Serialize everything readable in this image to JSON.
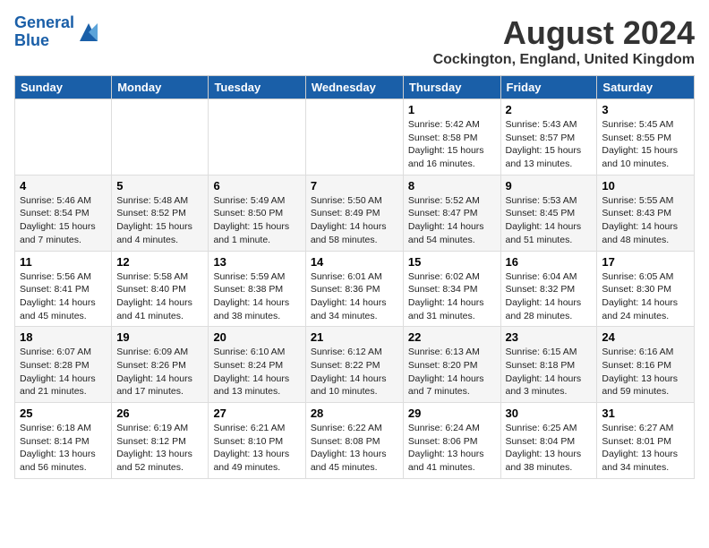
{
  "header": {
    "logo_line1": "General",
    "logo_line2": "Blue",
    "month_title": "August 2024",
    "location": "Cockington, England, United Kingdom"
  },
  "weekdays": [
    "Sunday",
    "Monday",
    "Tuesday",
    "Wednesday",
    "Thursday",
    "Friday",
    "Saturday"
  ],
  "weeks": [
    [
      null,
      null,
      null,
      null,
      {
        "day": "1",
        "sunrise": "5:42 AM",
        "sunset": "8:58 PM",
        "daylight": "15 hours and 16 minutes."
      },
      {
        "day": "2",
        "sunrise": "5:43 AM",
        "sunset": "8:57 PM",
        "daylight": "15 hours and 13 minutes."
      },
      {
        "day": "3",
        "sunrise": "5:45 AM",
        "sunset": "8:55 PM",
        "daylight": "15 hours and 10 minutes."
      }
    ],
    [
      {
        "day": "4",
        "sunrise": "5:46 AM",
        "sunset": "8:54 PM",
        "daylight": "15 hours and 7 minutes."
      },
      {
        "day": "5",
        "sunrise": "5:48 AM",
        "sunset": "8:52 PM",
        "daylight": "15 hours and 4 minutes."
      },
      {
        "day": "6",
        "sunrise": "5:49 AM",
        "sunset": "8:50 PM",
        "daylight": "15 hours and 1 minute."
      },
      {
        "day": "7",
        "sunrise": "5:50 AM",
        "sunset": "8:49 PM",
        "daylight": "14 hours and 58 minutes."
      },
      {
        "day": "8",
        "sunrise": "5:52 AM",
        "sunset": "8:47 PM",
        "daylight": "14 hours and 54 minutes."
      },
      {
        "day": "9",
        "sunrise": "5:53 AM",
        "sunset": "8:45 PM",
        "daylight": "14 hours and 51 minutes."
      },
      {
        "day": "10",
        "sunrise": "5:55 AM",
        "sunset": "8:43 PM",
        "daylight": "14 hours and 48 minutes."
      }
    ],
    [
      {
        "day": "11",
        "sunrise": "5:56 AM",
        "sunset": "8:41 PM",
        "daylight": "14 hours and 45 minutes."
      },
      {
        "day": "12",
        "sunrise": "5:58 AM",
        "sunset": "8:40 PM",
        "daylight": "14 hours and 41 minutes."
      },
      {
        "day": "13",
        "sunrise": "5:59 AM",
        "sunset": "8:38 PM",
        "daylight": "14 hours and 38 minutes."
      },
      {
        "day": "14",
        "sunrise": "6:01 AM",
        "sunset": "8:36 PM",
        "daylight": "14 hours and 34 minutes."
      },
      {
        "day": "15",
        "sunrise": "6:02 AM",
        "sunset": "8:34 PM",
        "daylight": "14 hours and 31 minutes."
      },
      {
        "day": "16",
        "sunrise": "6:04 AM",
        "sunset": "8:32 PM",
        "daylight": "14 hours and 28 minutes."
      },
      {
        "day": "17",
        "sunrise": "6:05 AM",
        "sunset": "8:30 PM",
        "daylight": "14 hours and 24 minutes."
      }
    ],
    [
      {
        "day": "18",
        "sunrise": "6:07 AM",
        "sunset": "8:28 PM",
        "daylight": "14 hours and 21 minutes."
      },
      {
        "day": "19",
        "sunrise": "6:09 AM",
        "sunset": "8:26 PM",
        "daylight": "14 hours and 17 minutes."
      },
      {
        "day": "20",
        "sunrise": "6:10 AM",
        "sunset": "8:24 PM",
        "daylight": "14 hours and 13 minutes."
      },
      {
        "day": "21",
        "sunrise": "6:12 AM",
        "sunset": "8:22 PM",
        "daylight": "14 hours and 10 minutes."
      },
      {
        "day": "22",
        "sunrise": "6:13 AM",
        "sunset": "8:20 PM",
        "daylight": "14 hours and 7 minutes."
      },
      {
        "day": "23",
        "sunrise": "6:15 AM",
        "sunset": "8:18 PM",
        "daylight": "14 hours and 3 minutes."
      },
      {
        "day": "24",
        "sunrise": "6:16 AM",
        "sunset": "8:16 PM",
        "daylight": "13 hours and 59 minutes."
      }
    ],
    [
      {
        "day": "25",
        "sunrise": "6:18 AM",
        "sunset": "8:14 PM",
        "daylight": "13 hours and 56 minutes."
      },
      {
        "day": "26",
        "sunrise": "6:19 AM",
        "sunset": "8:12 PM",
        "daylight": "13 hours and 52 minutes."
      },
      {
        "day": "27",
        "sunrise": "6:21 AM",
        "sunset": "8:10 PM",
        "daylight": "13 hours and 49 minutes."
      },
      {
        "day": "28",
        "sunrise": "6:22 AM",
        "sunset": "8:08 PM",
        "daylight": "13 hours and 45 minutes."
      },
      {
        "day": "29",
        "sunrise": "6:24 AM",
        "sunset": "8:06 PM",
        "daylight": "13 hours and 41 minutes."
      },
      {
        "day": "30",
        "sunrise": "6:25 AM",
        "sunset": "8:04 PM",
        "daylight": "13 hours and 38 minutes."
      },
      {
        "day": "31",
        "sunrise": "6:27 AM",
        "sunset": "8:01 PM",
        "daylight": "13 hours and 34 minutes."
      }
    ]
  ],
  "labels": {
    "sunrise": "Sunrise:",
    "sunset": "Sunset:",
    "daylight": "Daylight:"
  }
}
